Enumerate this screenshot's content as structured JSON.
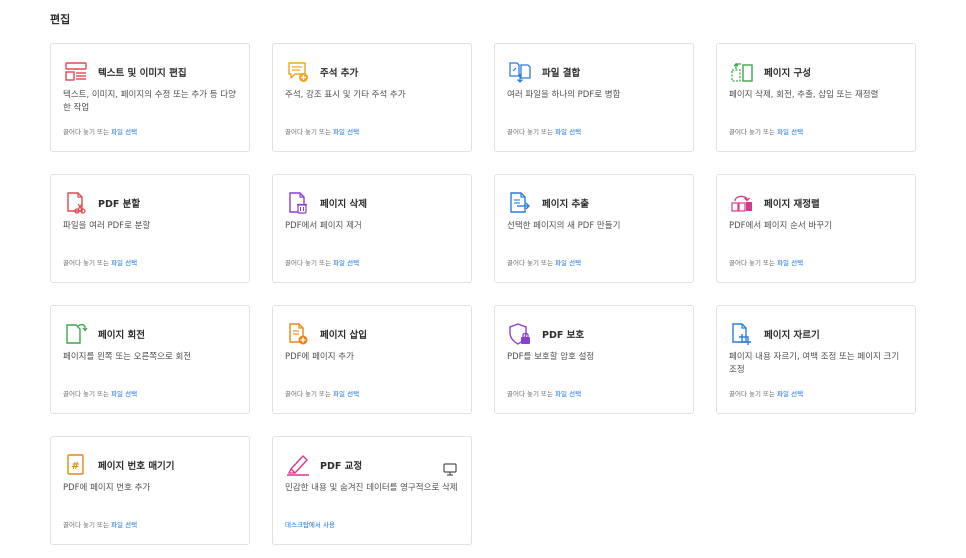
{
  "section": {
    "title": "편집"
  },
  "cards": [
    {
      "id": "edit-text-image",
      "icon": "edit-text-image-icon",
      "title": "텍스트 및 이미지 편집",
      "desc": "텍스트, 이미지, 페이지의 수정 또는 추가 등 다양한 작업",
      "foot_prefix": "끌어다 놓기 또는",
      "foot_link": "파일 선택"
    },
    {
      "id": "comment",
      "icon": "comment-add-icon",
      "title": "주석 추가",
      "desc": "주석, 강조 표시 및 기타 주석 추가",
      "foot_prefix": "끌어다 놓기 또는",
      "foot_link": "파일 선택"
    },
    {
      "id": "combine",
      "icon": "combine-files-icon",
      "title": "파일 결합",
      "desc": "여러 파일을 하나의 PDF로 병합",
      "foot_prefix": "끌어다 놓기 또는",
      "foot_link": "파일 선택"
    },
    {
      "id": "organize",
      "icon": "organize-pages-icon",
      "title": "페이지 구성",
      "desc": "페이지 삭제, 회전, 추출, 삽입 또는 재정렬",
      "foot_prefix": "끌어다 놓기 또는",
      "foot_link": "파일 선택"
    },
    {
      "id": "split",
      "icon": "split-pdf-icon",
      "title": "PDF 분할",
      "desc": "파일을 여러 PDF로 분할",
      "foot_prefix": "끌어다 놓기 또는",
      "foot_link": "파일 선택"
    },
    {
      "id": "delete",
      "icon": "delete-pages-icon",
      "title": "페이지 삭제",
      "desc": "PDF에서 페이지 제거",
      "foot_prefix": "끌어다 놓기 또는",
      "foot_link": "파일 선택"
    },
    {
      "id": "extract",
      "icon": "extract-pages-icon",
      "title": "페이지 추출",
      "desc": "선택한 페이지의 새 PDF 만들기",
      "foot_prefix": "끌어다 놓기 또는",
      "foot_link": "파일 선택"
    },
    {
      "id": "reorder",
      "icon": "reorder-pages-icon",
      "title": "페이지 재정렬",
      "desc": "PDF에서 페이지 순서 바꾸기",
      "foot_prefix": "끌어다 놓기 또는",
      "foot_link": "파일 선택"
    },
    {
      "id": "rotate",
      "icon": "rotate-pages-icon",
      "title": "페이지 회전",
      "desc": "페이지를 왼쪽 또는 오른쪽으로 회전",
      "foot_prefix": "끌어다 놓기 또는",
      "foot_link": "파일 선택"
    },
    {
      "id": "insert",
      "icon": "insert-pages-icon",
      "title": "페이지 삽입",
      "desc": "PDF에 페이지 추가",
      "foot_prefix": "끌어다 놓기 또는",
      "foot_link": "파일 선택"
    },
    {
      "id": "protect",
      "icon": "protect-pdf-icon",
      "title": "PDF 보호",
      "desc": "PDF를 보호할 암호 설정",
      "foot_prefix": "끌어다 놓기 또는",
      "foot_link": "파일 선택"
    },
    {
      "id": "crop",
      "icon": "crop-pages-icon",
      "title": "페이지 자르기",
      "desc": "페이지 내용 자르기, 여백 조정 또는 페이지 크기 조정",
      "foot_prefix": "끌어다 놓기 또는",
      "foot_link": "파일 선택"
    },
    {
      "id": "number",
      "icon": "page-numbers-icon",
      "title": "페이지 번호 매기기",
      "desc": "PDF에 페이지 번호 추가",
      "foot_prefix": "끌어다 놓기 또는",
      "foot_link": "파일 선택"
    },
    {
      "id": "redact",
      "icon": "redact-pdf-icon",
      "title": "PDF 교정",
      "desc": "민감한 내용 및 숨겨진 데이터를 영구적으로 삭제",
      "foot_desktop": "데스크탑에서 사용",
      "extra_icon": "desktop-monitor-icon"
    }
  ],
  "colors": {
    "link": "#1473e6",
    "red": "#e34850",
    "yellow": "#f0a51a",
    "blue": "#2b7de1",
    "green": "#3da74e",
    "orange": "#e68619",
    "pink": "#d83790",
    "purple": "#8a3fd1"
  }
}
